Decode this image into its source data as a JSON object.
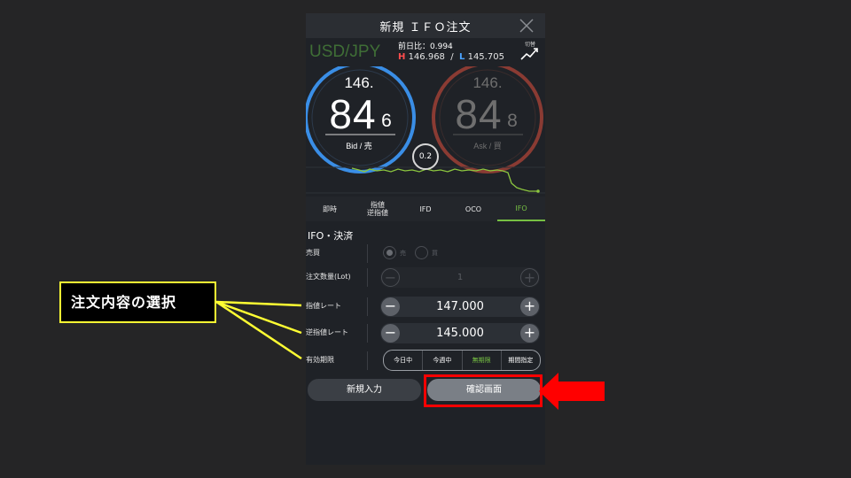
{
  "header": {
    "title": "新規 ＩＦＯ注文",
    "close_icon": "close-icon"
  },
  "pair": "USD/JPY",
  "prev_change": "前日比：0.994",
  "high": {
    "label": "H",
    "value": "146.968"
  },
  "low": {
    "label": "L",
    "value": "145.705"
  },
  "chart_button": {
    "label": "切替",
    "icon": "trend-chart-icon"
  },
  "bid": {
    "head": "146.",
    "main": "84",
    "tail": "6",
    "label": "Bid / 売"
  },
  "ask": {
    "head": "146.",
    "main": "84",
    "tail": "8",
    "label": "Ask / 買"
  },
  "spread": "0.2",
  "tabs": [
    {
      "label": "即時"
    },
    {
      "label": "指値\n逆指値"
    },
    {
      "label": "IFD"
    },
    {
      "label": "OCO"
    },
    {
      "label": "IFO",
      "active": true
    }
  ],
  "section_title": "IFO・決済",
  "form": {
    "side": {
      "label": "売買",
      "options": [
        "売",
        "買"
      ],
      "selected": "売"
    },
    "quantity": {
      "label": "注文数量(Lot)",
      "value": "1"
    },
    "limit_rate": {
      "label": "指値レート",
      "value": "147.000"
    },
    "stop_rate": {
      "label": "逆指値レート",
      "value": "145.000"
    },
    "expiry": {
      "label": "有効期限",
      "options": [
        "今日中",
        "今週中",
        "無期限",
        "期間指定"
      ],
      "selected": "無期限"
    }
  },
  "buttons": {
    "new_input": "新規入力",
    "confirm": "確認画面"
  },
  "callout": "注文内容の選択",
  "colors": {
    "bid_ring": "#3a8ee6",
    "ask_ring": "#8a3b33",
    "active_green": "#76c043",
    "highlight_red": "#ff0000",
    "callout_yellow": "#ffff33"
  }
}
